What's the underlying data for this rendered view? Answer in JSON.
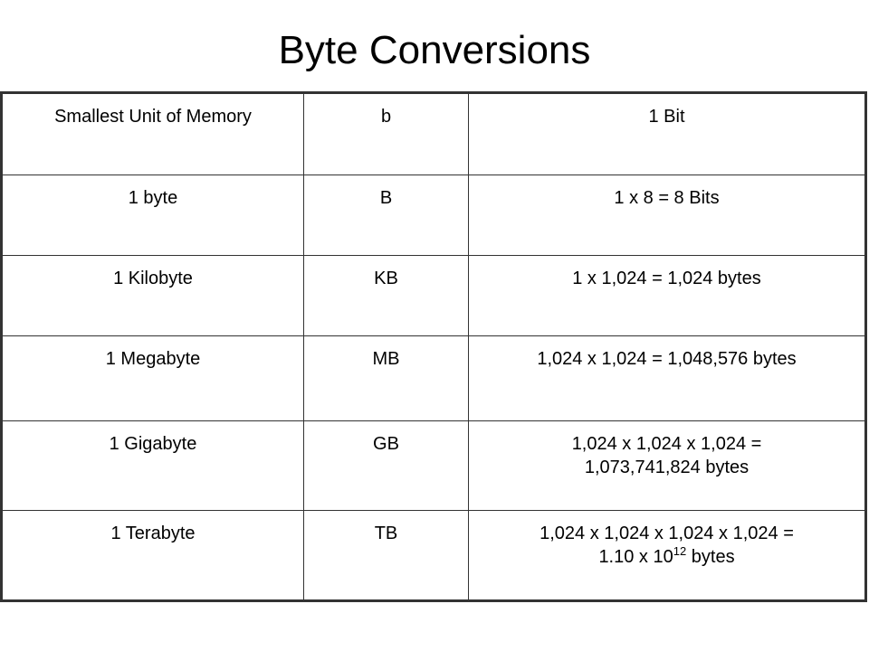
{
  "title": "Byte Conversions",
  "rows": [
    {
      "name": "Smallest Unit of Memory",
      "symbol": "b",
      "value": "1 Bit"
    },
    {
      "name": "1 byte",
      "symbol": "B",
      "value": "1 x 8 = 8 Bits"
    },
    {
      "name": "1 Kilobyte",
      "symbol": "KB",
      "value": "1 x 1,024 = 1,024 bytes"
    },
    {
      "name": "1 Megabyte",
      "symbol": "MB",
      "value": "1,024 x 1,024 = 1,048,576 bytes"
    },
    {
      "name": "1 Gigabyte",
      "symbol": "GB",
      "value": "1,024 x 1,024 x 1,024 = 1,073,741,824 bytes"
    },
    {
      "name": "1 Terabyte",
      "symbol": "TB",
      "value_line1": "1,024 x 1,024 x 1,024 x 1,024 =",
      "value_base": "1.10 x 10",
      "value_exp": "12",
      "value_unit": " bytes"
    }
  ]
}
